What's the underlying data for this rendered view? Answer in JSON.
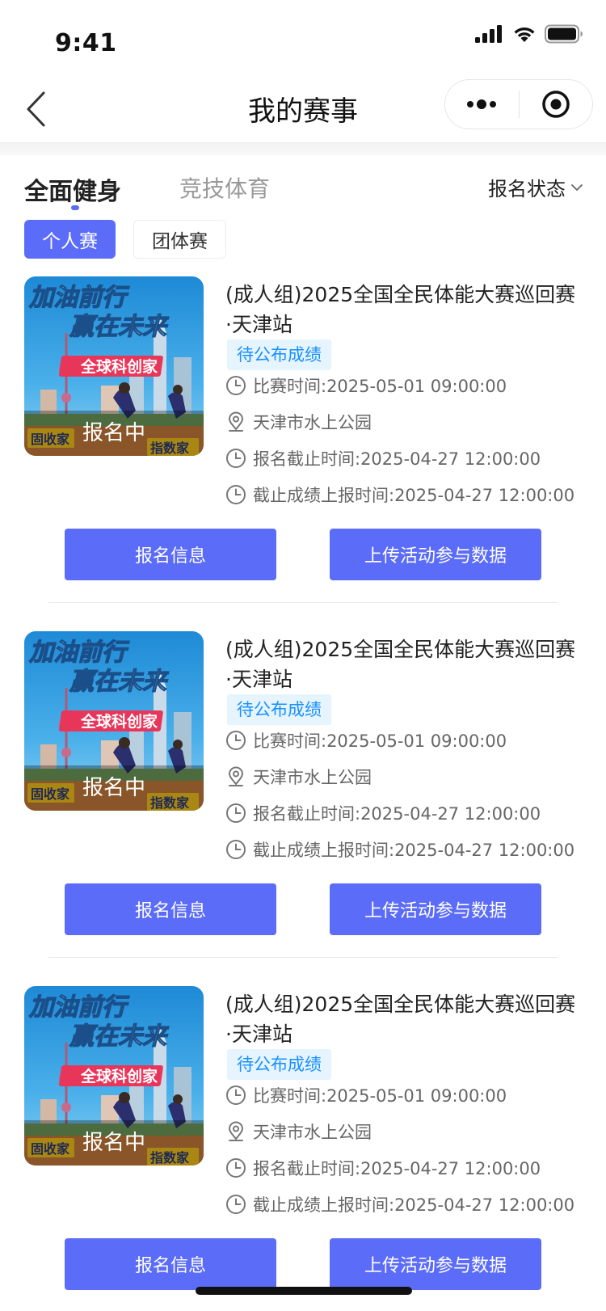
{
  "status_bar": {
    "time": "9:41"
  },
  "nav": {
    "title": "我的赛事"
  },
  "tabs": [
    {
      "label": "全面健身",
      "active": true
    },
    {
      "label": "竞技体育",
      "active": false
    }
  ],
  "filter": {
    "label": "报名状态"
  },
  "subtabs": [
    {
      "label": "个人赛",
      "active": true
    },
    {
      "label": "团体赛",
      "active": false
    }
  ],
  "events": [
    {
      "poster": {
        "line1": "加油前行",
        "line2": "赢在未来",
        "banner": "全球科创家",
        "corner_left": "固收家",
        "corner_right": "指数家"
      },
      "reg_status": "报名中",
      "title": "(成人组)2025全国全民体能大赛巡回赛·天津站",
      "badge": "待公布成绩",
      "match_time": "比赛时间:2025-05-01 09:00:00",
      "location": "天津市水上公园",
      "reg_deadline": "报名截止时间:2025-04-27 12:00:00",
      "score_deadline": "截止成绩上报时间:2025-04-27 12:00:00",
      "btn_info": "报名信息",
      "btn_upload": "上传活动参与数据"
    },
    {
      "poster": {
        "line1": "加油前行",
        "line2": "赢在未来",
        "banner": "全球科创家",
        "corner_left": "固收家",
        "corner_right": "指数家"
      },
      "reg_status": "报名中",
      "title": "(成人组)2025全国全民体能大赛巡回赛·天津站",
      "badge": "待公布成绩",
      "match_time": "比赛时间:2025-05-01 09:00:00",
      "location": "天津市水上公园",
      "reg_deadline": "报名截止时间:2025-04-27 12:00:00",
      "score_deadline": "截止成绩上报时间:2025-04-27 12:00:00",
      "btn_info": "报名信息",
      "btn_upload": "上传活动参与数据"
    },
    {
      "poster": {
        "line1": "加油前行",
        "line2": "赢在未来",
        "banner": "全球科创家",
        "corner_left": "固收家",
        "corner_right": "指数家"
      },
      "reg_status": "报名中",
      "title": "(成人组)2025全国全民体能大赛巡回赛·天津站",
      "badge": "待公布成绩",
      "match_time": "比赛时间:2025-05-01 09:00:00",
      "location": "天津市水上公园",
      "reg_deadline": "报名截止时间:2025-04-27 12:00:00",
      "score_deadline": "截止成绩上报时间:2025-04-27 12:00:00",
      "btn_info": "报名信息",
      "btn_upload": "上传活动参与数据"
    }
  ],
  "colors": {
    "accent": "#5b6cf8",
    "badge_bg": "#e6f4fe",
    "badge_text": "#1890ff"
  }
}
